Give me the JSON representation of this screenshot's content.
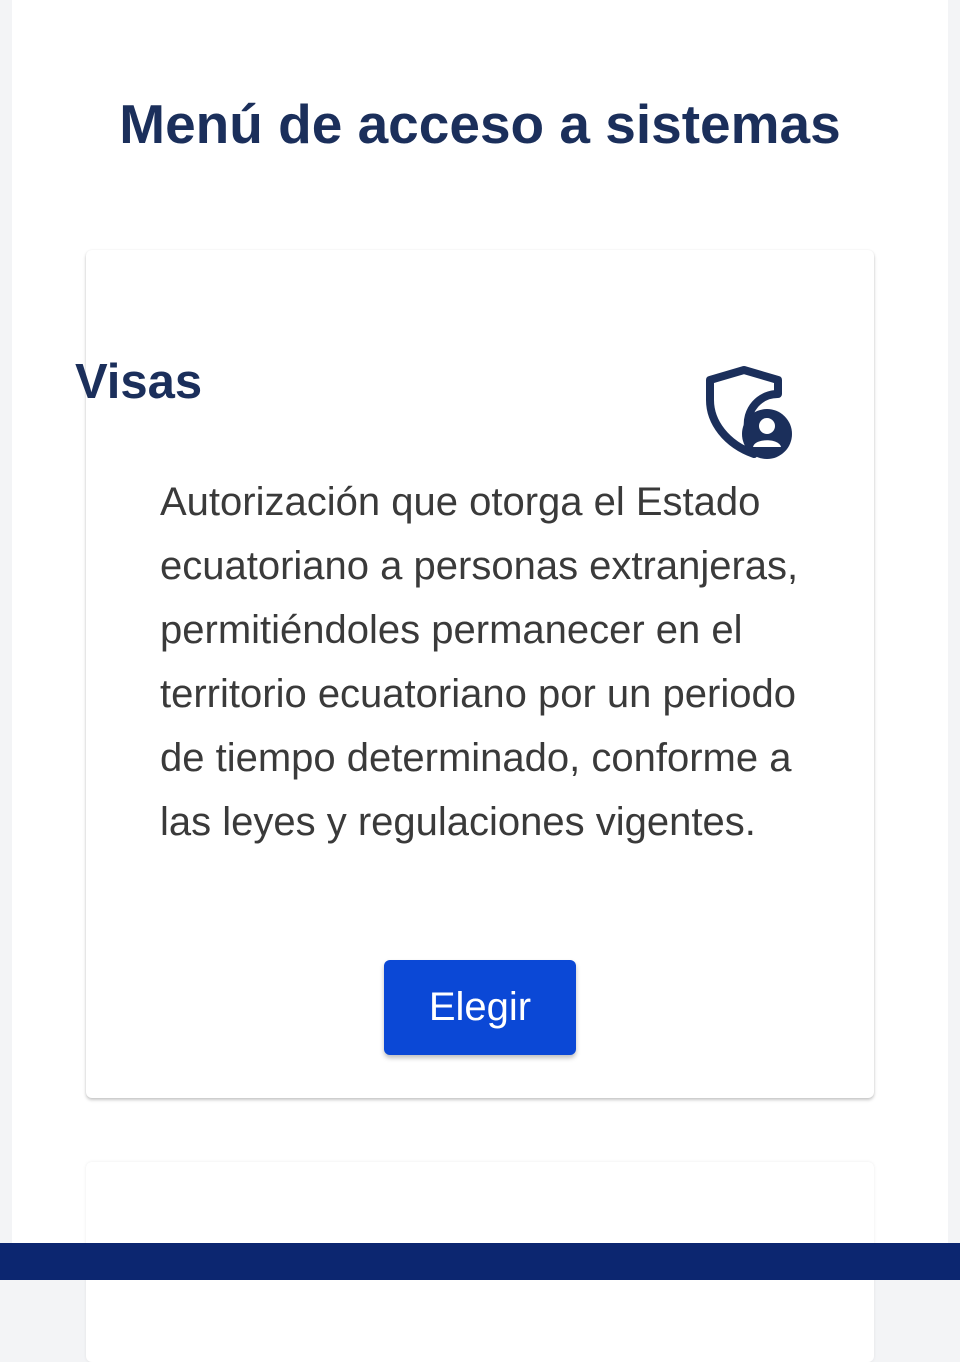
{
  "page": {
    "title": "Menú de acceso a sistemas"
  },
  "cards": [
    {
      "title": "Visas",
      "icon": "shield-user-icon",
      "description": "Autorización que otorga el Estado ecuatoriano a personas extranjeras, permitiéndoles permanecer en el territorio ecuatoriano por un periodo de tiempo determinado, conforme a las leyes y regulaciones vigentes.",
      "button_label": "Elegir"
    }
  ],
  "colors": {
    "title": "#1b2f5b",
    "button": "#0b48d6",
    "bottom_bar": "#0c2670",
    "text": "#3a3a3a"
  }
}
